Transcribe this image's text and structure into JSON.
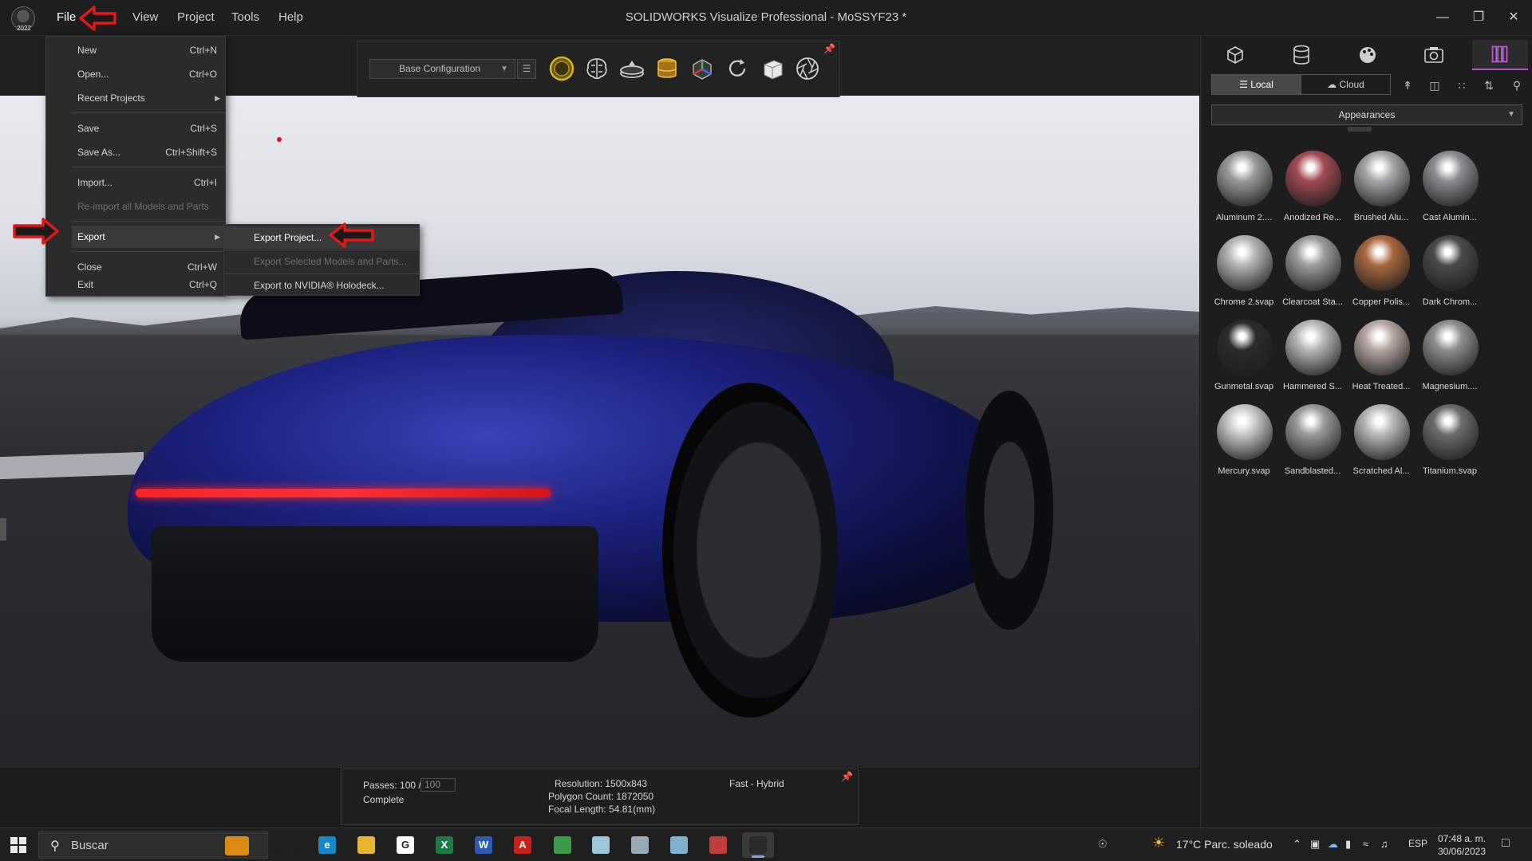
{
  "app": {
    "title": "SOLIDWORKS Visualize Professional - MoSSYF23 *",
    "logo_year": "2022",
    "menu": [
      "File",
      "View",
      "Project",
      "Tools",
      "Help"
    ],
    "window_controls": [
      "minimize-icon",
      "restore-icon",
      "close-icon"
    ]
  },
  "file_menu": {
    "items": [
      {
        "label": "New",
        "shortcut": "Ctrl+N"
      },
      {
        "label": "Open...",
        "shortcut": "Ctrl+O"
      },
      {
        "label": "Recent Projects",
        "shortcut": ""
      },
      {
        "label": "Save",
        "shortcut": "Ctrl+S"
      },
      {
        "label": "Save As...",
        "shortcut": "Ctrl+Shift+S"
      },
      {
        "label": "Import...",
        "shortcut": "Ctrl+I"
      },
      {
        "label": "Re-import all Models and Parts",
        "shortcut": ""
      },
      {
        "label": "Export",
        "shortcut": ""
      },
      {
        "label": "Close",
        "shortcut": "Ctrl+W"
      },
      {
        "label": "Exit",
        "shortcut": "Ctrl+Q"
      }
    ]
  },
  "export_menu": {
    "items": [
      {
        "label": "Export Project..."
      },
      {
        "label": "Export Selected Models and Parts..."
      },
      {
        "label": "Export to NVIDIA® Holodeck..."
      }
    ]
  },
  "toolbar": {
    "configuration": "Base Configuration",
    "icons": [
      "camera-mode-icon",
      "brain-icon",
      "turntable-icon",
      "database-icon",
      "cube-axis-icon",
      "refresh-icon",
      "box-render-icon",
      "aperture-icon"
    ]
  },
  "right_panel": {
    "tabs": [
      "model-icon",
      "database-icon",
      "palette-icon",
      "camera-icon",
      "library-icon"
    ],
    "active_tab": 4,
    "local_label": "Local",
    "cloud_label": "Cloud",
    "dropdown": "Appearances",
    "swatches": [
      {
        "label": "Aluminum 2....",
        "color": "#9a9a9a"
      },
      {
        "label": "Anodized Re...",
        "color": "#a24a52"
      },
      {
        "label": "Brushed Alu...",
        "color": "#a7a7a9"
      },
      {
        "label": "Cast Alumin...",
        "color": "#8c8d8f"
      },
      {
        "label": "Chrome 2.svap",
        "color": "#b4b4b4"
      },
      {
        "label": "Clearcoat Sta...",
        "color": "#9c9c9c"
      },
      {
        "label": "Copper Polis...",
        "color": "#a8683e"
      },
      {
        "label": "Dark Chrom...",
        "color": "#4a4a4a"
      },
      {
        "label": "Gunmetal.svap",
        "color": "#2b2b2d"
      },
      {
        "label": "Hammered S...",
        "color": "#b6b6b6"
      },
      {
        "label": "Heat Treated...",
        "color": "#b6a7a2"
      },
      {
        "label": "Magnesium....",
        "color": "#8e8e8e"
      },
      {
        "label": "Mercury.svap",
        "color": "#c8c8c8"
      },
      {
        "label": "Sandblasted...",
        "color": "#9a9a9a"
      },
      {
        "label": "Scratched Al...",
        "color": "#b9b9b9"
      },
      {
        "label": "Titanium.svap",
        "color": "#6c6c6c"
      }
    ]
  },
  "status": {
    "passes_label": "Passes: 100 /",
    "passes_value": "100",
    "complete": "Complete",
    "resolution": "Resolution: 1500x843",
    "polygon_count": "Polygon Count: 1872050",
    "focal_length": "Focal Length: 54.81(mm)",
    "mode": "Fast - Hybrid"
  },
  "taskbar": {
    "search_placeholder": "Buscar",
    "weather": "17°C  Parc. soleado",
    "language": "ESP",
    "time": "07:48 a. m.",
    "date": "30/06/2023",
    "apps": [
      {
        "name": "task-view-icon",
        "glyph": "",
        "color": "#1f1f1f"
      },
      {
        "name": "edge-icon",
        "glyph": "e",
        "color": "#1687c9"
      },
      {
        "name": "file-explorer-icon",
        "glyph": "",
        "color": "#e9b430"
      },
      {
        "name": "g-app-icon",
        "glyph": "G",
        "color": "#ffffff"
      },
      {
        "name": "excel-icon",
        "glyph": "X",
        "color": "#1d7a44"
      },
      {
        "name": "word-icon",
        "glyph": "W",
        "color": "#2b5bb7"
      },
      {
        "name": "acrobat-icon",
        "glyph": "A",
        "color": "#c8201a"
      },
      {
        "name": "chrome-icon",
        "glyph": "",
        "color": "#3d9a4b"
      },
      {
        "name": "notes-icon",
        "glyph": "",
        "color": "#9cc6d9"
      },
      {
        "name": "mail-app-icon",
        "glyph": "",
        "color": "#9aa7b5"
      },
      {
        "name": "paint-app-icon",
        "glyph": "",
        "color": "#7fb0d0"
      },
      {
        "name": "composer-app-icon",
        "glyph": "",
        "color": "#c23b3b"
      },
      {
        "name": "visualize-app-icon",
        "glyph": "",
        "color": "#2a2a2a"
      }
    ]
  }
}
